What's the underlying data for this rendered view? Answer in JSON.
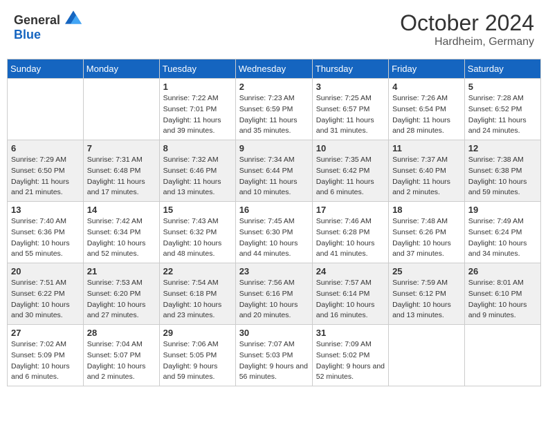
{
  "header": {
    "logo_general": "General",
    "logo_blue": "Blue",
    "month_title": "October 2024",
    "location": "Hardheim, Germany"
  },
  "days_of_week": [
    "Sunday",
    "Monday",
    "Tuesday",
    "Wednesday",
    "Thursday",
    "Friday",
    "Saturday"
  ],
  "weeks": [
    [
      {
        "day": "",
        "info": ""
      },
      {
        "day": "",
        "info": ""
      },
      {
        "day": "1",
        "info": "Sunrise: 7:22 AM\nSunset: 7:01 PM\nDaylight: 11 hours and 39 minutes."
      },
      {
        "day": "2",
        "info": "Sunrise: 7:23 AM\nSunset: 6:59 PM\nDaylight: 11 hours and 35 minutes."
      },
      {
        "day": "3",
        "info": "Sunrise: 7:25 AM\nSunset: 6:57 PM\nDaylight: 11 hours and 31 minutes."
      },
      {
        "day": "4",
        "info": "Sunrise: 7:26 AM\nSunset: 6:54 PM\nDaylight: 11 hours and 28 minutes."
      },
      {
        "day": "5",
        "info": "Sunrise: 7:28 AM\nSunset: 6:52 PM\nDaylight: 11 hours and 24 minutes."
      }
    ],
    [
      {
        "day": "6",
        "info": "Sunrise: 7:29 AM\nSunset: 6:50 PM\nDaylight: 11 hours and 21 minutes."
      },
      {
        "day": "7",
        "info": "Sunrise: 7:31 AM\nSunset: 6:48 PM\nDaylight: 11 hours and 17 minutes."
      },
      {
        "day": "8",
        "info": "Sunrise: 7:32 AM\nSunset: 6:46 PM\nDaylight: 11 hours and 13 minutes."
      },
      {
        "day": "9",
        "info": "Sunrise: 7:34 AM\nSunset: 6:44 PM\nDaylight: 11 hours and 10 minutes."
      },
      {
        "day": "10",
        "info": "Sunrise: 7:35 AM\nSunset: 6:42 PM\nDaylight: 11 hours and 6 minutes."
      },
      {
        "day": "11",
        "info": "Sunrise: 7:37 AM\nSunset: 6:40 PM\nDaylight: 11 hours and 2 minutes."
      },
      {
        "day": "12",
        "info": "Sunrise: 7:38 AM\nSunset: 6:38 PM\nDaylight: 10 hours and 59 minutes."
      }
    ],
    [
      {
        "day": "13",
        "info": "Sunrise: 7:40 AM\nSunset: 6:36 PM\nDaylight: 10 hours and 55 minutes."
      },
      {
        "day": "14",
        "info": "Sunrise: 7:42 AM\nSunset: 6:34 PM\nDaylight: 10 hours and 52 minutes."
      },
      {
        "day": "15",
        "info": "Sunrise: 7:43 AM\nSunset: 6:32 PM\nDaylight: 10 hours and 48 minutes."
      },
      {
        "day": "16",
        "info": "Sunrise: 7:45 AM\nSunset: 6:30 PM\nDaylight: 10 hours and 44 minutes."
      },
      {
        "day": "17",
        "info": "Sunrise: 7:46 AM\nSunset: 6:28 PM\nDaylight: 10 hours and 41 minutes."
      },
      {
        "day": "18",
        "info": "Sunrise: 7:48 AM\nSunset: 6:26 PM\nDaylight: 10 hours and 37 minutes."
      },
      {
        "day": "19",
        "info": "Sunrise: 7:49 AM\nSunset: 6:24 PM\nDaylight: 10 hours and 34 minutes."
      }
    ],
    [
      {
        "day": "20",
        "info": "Sunrise: 7:51 AM\nSunset: 6:22 PM\nDaylight: 10 hours and 30 minutes."
      },
      {
        "day": "21",
        "info": "Sunrise: 7:53 AM\nSunset: 6:20 PM\nDaylight: 10 hours and 27 minutes."
      },
      {
        "day": "22",
        "info": "Sunrise: 7:54 AM\nSunset: 6:18 PM\nDaylight: 10 hours and 23 minutes."
      },
      {
        "day": "23",
        "info": "Sunrise: 7:56 AM\nSunset: 6:16 PM\nDaylight: 10 hours and 20 minutes."
      },
      {
        "day": "24",
        "info": "Sunrise: 7:57 AM\nSunset: 6:14 PM\nDaylight: 10 hours and 16 minutes."
      },
      {
        "day": "25",
        "info": "Sunrise: 7:59 AM\nSunset: 6:12 PM\nDaylight: 10 hours and 13 minutes."
      },
      {
        "day": "26",
        "info": "Sunrise: 8:01 AM\nSunset: 6:10 PM\nDaylight: 10 hours and 9 minutes."
      }
    ],
    [
      {
        "day": "27",
        "info": "Sunrise: 7:02 AM\nSunset: 5:09 PM\nDaylight: 10 hours and 6 minutes."
      },
      {
        "day": "28",
        "info": "Sunrise: 7:04 AM\nSunset: 5:07 PM\nDaylight: 10 hours and 2 minutes."
      },
      {
        "day": "29",
        "info": "Sunrise: 7:06 AM\nSunset: 5:05 PM\nDaylight: 9 hours and 59 minutes."
      },
      {
        "day": "30",
        "info": "Sunrise: 7:07 AM\nSunset: 5:03 PM\nDaylight: 9 hours and 56 minutes."
      },
      {
        "day": "31",
        "info": "Sunrise: 7:09 AM\nSunset: 5:02 PM\nDaylight: 9 hours and 52 minutes."
      },
      {
        "day": "",
        "info": ""
      },
      {
        "day": "",
        "info": ""
      }
    ]
  ]
}
